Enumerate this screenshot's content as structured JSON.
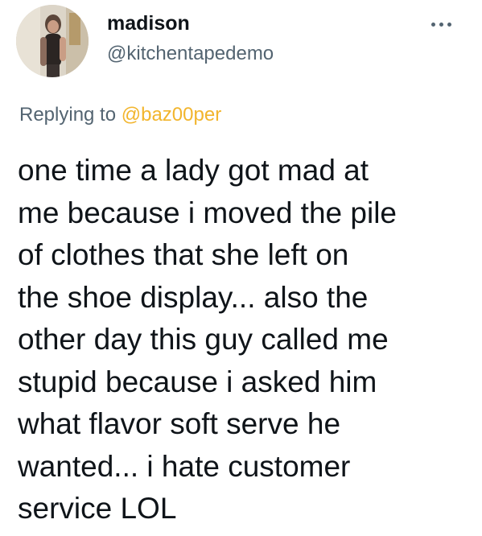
{
  "author": {
    "display_name": "madison",
    "handle": "@kitchentapedemo",
    "avatar_icon": "profile-photo"
  },
  "more_icon": "ellipsis-icon",
  "reply": {
    "prefix": "Replying to",
    "mention": "@baz00per",
    "mention_color": "#f2b52d"
  },
  "text_lines": [
    "one time a lady got mad at",
    "me because i moved the pile",
    "of clothes that she left on",
    "the shoe display... also the",
    "other day this guy called me",
    "stupid because i asked him",
    "what flavor soft serve he",
    "wanted... i hate customer",
    "service LOL"
  ],
  "colors": {
    "text": "#0f1419",
    "secondary": "#536471",
    "background": "#ffffff"
  }
}
